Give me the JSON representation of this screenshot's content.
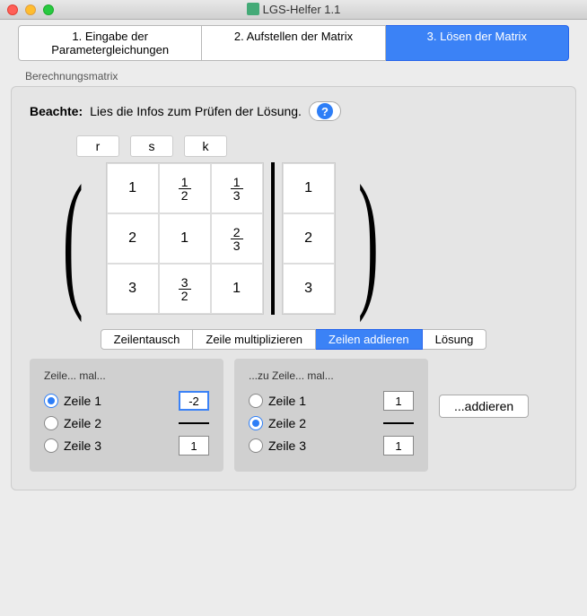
{
  "window": {
    "title": "LGS-Helfer 1.1"
  },
  "main_tabs": [
    {
      "label": "1. Eingabe der Parametergleichungen",
      "active": false
    },
    {
      "label": "2. Aufstellen der Matrix",
      "active": false
    },
    {
      "label": "3. Lösen der Matrix",
      "active": true
    }
  ],
  "group_label": "Berechnungsmatrix",
  "notice": {
    "bold": "Beachte:",
    "text": "Lies die Infos zum Prüfen der Lösung."
  },
  "col_headers": [
    "r",
    "s",
    "k"
  ],
  "matrix": [
    [
      "1",
      {
        "n": "1",
        "d": "2"
      },
      {
        "n": "1",
        "d": "3"
      }
    ],
    [
      "2",
      "1",
      {
        "n": "2",
        "d": "3"
      }
    ],
    [
      "3",
      {
        "n": "3",
        "d": "2"
      },
      "1"
    ]
  ],
  "rhs": [
    "1",
    "2",
    "3"
  ],
  "sub_tabs": [
    {
      "label": "Zeilentausch",
      "active": false
    },
    {
      "label": "Zeile multiplizieren",
      "active": false
    },
    {
      "label": "Zeilen addieren",
      "active": true
    },
    {
      "label": "Lösung",
      "active": false
    }
  ],
  "op_left": {
    "label": "Zeile... mal...",
    "rows": [
      {
        "label": "Zeile 1",
        "value": "-2",
        "checked": true,
        "focus": true
      },
      {
        "label": "Zeile 2",
        "value": "",
        "divider": true,
        "checked": false
      },
      {
        "label": "Zeile 3",
        "value": "1",
        "checked": false
      }
    ]
  },
  "op_right": {
    "label": "...zu Zeile... mal...",
    "rows": [
      {
        "label": "Zeile 1",
        "value": "1",
        "checked": false
      },
      {
        "label": "Zeile 2",
        "value": "",
        "divider": true,
        "checked": true
      },
      {
        "label": "Zeile 3",
        "value": "1",
        "checked": false
      }
    ]
  },
  "add_button": "...addieren"
}
